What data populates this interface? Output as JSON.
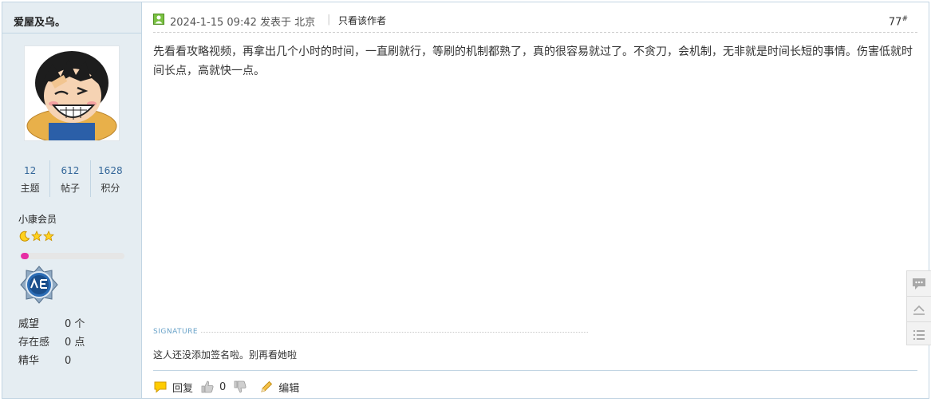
{
  "author": {
    "name": "爱屋及乌。",
    "stats": [
      {
        "value": "12",
        "label": "主题"
      },
      {
        "value": "612",
        "label": "帖子"
      },
      {
        "value": "1628",
        "label": "积分"
      }
    ],
    "member_level": "小康会员",
    "level_progress_percent": 8,
    "info": [
      {
        "key": "威望",
        "value": "0 个"
      },
      {
        "key": "存在感",
        "value": "0 点"
      },
      {
        "key": "精华",
        "value": "0"
      }
    ]
  },
  "post": {
    "time": "2024-1-15 09:42",
    "posted_in_label": "发表于",
    "location": "北京",
    "only_author_label": "只看该作者",
    "floor_number": "77",
    "floor_suffix": "#",
    "content": "先看看攻略视频，再拿出几个小时的时间，一直刷就行，等刷的机制都熟了，真的很容易就过了。不贪刀，会机制，无非就是时间长短的事情。伤害低就时间长点，高就快一点。",
    "signature_label": "SIGNATURE",
    "signature_text": "这人还没添加签名啦。别再看她啦"
  },
  "actions": {
    "reply_label": "回复",
    "like_count": "0",
    "edit_label": "编辑"
  },
  "colors": {
    "accent_blue": "#336699",
    "sidebar_bg": "#e5edf2",
    "border": "#c2d5e3",
    "level_bar": "#e62ea5"
  }
}
